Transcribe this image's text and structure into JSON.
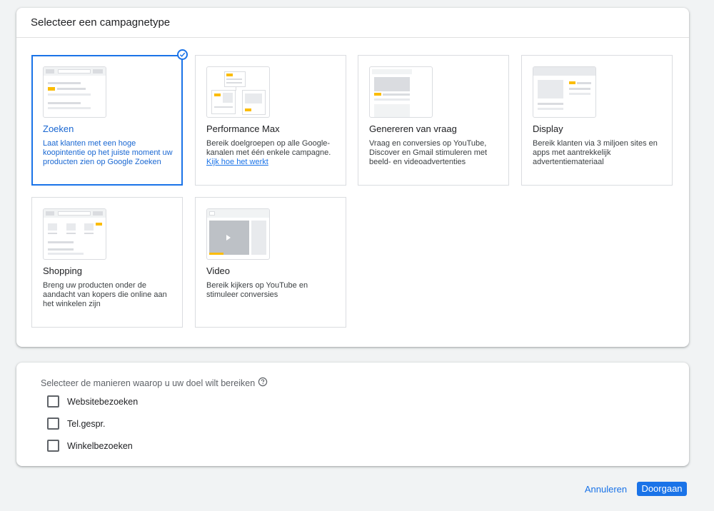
{
  "types_panel": {
    "title": "Selecteer een campagnetype",
    "cards": [
      {
        "title": "Zoeken",
        "desc": "Laat klanten met een hoge koopintentie op het juiste moment uw producten zien op Google Zoeken",
        "selected": true
      },
      {
        "title": "Performance Max",
        "desc": "Bereik doelgroepen op alle Google-kanalen met één enkele campagne.",
        "link": "Kijk hoe het werkt"
      },
      {
        "title": "Genereren van vraag",
        "desc": "Vraag en conversies op YouTube, Discover en Gmail stimuleren met beeld- en videoadvertenties"
      },
      {
        "title": "Display",
        "desc": "Bereik klanten via 3 miljoen sites en apps met aantrekkelijk advertentiemateriaal"
      },
      {
        "title": "Shopping",
        "desc": "Breng uw producten onder de aandacht van kopers die online aan het winkelen zijn"
      },
      {
        "title": "Video",
        "desc": "Bereik kijkers op YouTube en stimuleer conversies"
      }
    ]
  },
  "goals_panel": {
    "label": "Selecteer de manieren waarop u uw doel wilt bereiken",
    "options": [
      {
        "label": "Websitebezoeken",
        "checked": false
      },
      {
        "label": "Tel.gespr.",
        "checked": false
      },
      {
        "label": "Winkelbezoeken",
        "checked": false
      }
    ]
  },
  "footer": {
    "cancel_label": "Annuleren",
    "next_label": "Doorgaan"
  },
  "colors": {
    "accent": "#1a73e8",
    "illustration_yellow": "#fbbc04",
    "illustration_gray": "#dadce0"
  },
  "icons": {
    "selected": "check-circle-icon",
    "help": "help-circle-icon"
  }
}
